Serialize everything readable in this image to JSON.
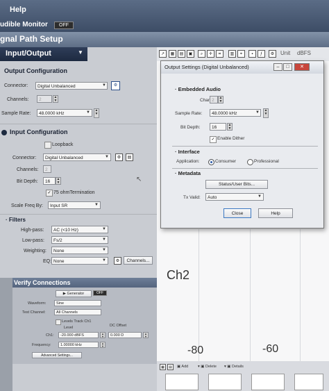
{
  "menu": {
    "help": "Help"
  },
  "audible_monitor": {
    "label": "udible Monitor",
    "state": "OFF"
  },
  "signal_path": {
    "title": "gnal Path Setup"
  },
  "io": {
    "title": "Input/Output",
    "dropdown_icon": "triangle-down"
  },
  "output_config": {
    "title": "Output Configuration",
    "connector_label": "Connector:",
    "connector_value": "Digital Unbalanced",
    "channels_label": "Channels:",
    "channels_value": "2",
    "sample_rate_label": "Sample Rate:",
    "sample_rate_value": "48.0000 kHz"
  },
  "input_config": {
    "title": "Input Configuration",
    "loopback_label": "Loopback",
    "connector_label": "Connector:",
    "connector_value": "Digital Unbalanced",
    "channels_label": "Channels:",
    "channels_value": "2",
    "bit_depth_label": "Bit Depth:",
    "bit_depth_value": "16",
    "termination_label": "75 ohmTermination",
    "scale_freq_label": "Scale Freq By:",
    "scale_freq_value": "Input SR"
  },
  "filters": {
    "title": "Filters",
    "highpass_label": "High-pass:",
    "highpass_value": "AC (<10 Hz)",
    "lowpass_label": "Low-pass:",
    "lowpass_value": "Fs/2",
    "weighting_label": "Weighting:",
    "weighting_value": "None",
    "eq_label": "EQ:",
    "eq_value": "None",
    "channels_button": "Channels..."
  },
  "verify": {
    "title": "Verify Connections",
    "generator_label": "Generator",
    "generator_state": "OFF",
    "waveform_label": "Waveform:",
    "waveform_value": "Sine",
    "test_channel_label": "Test Channel:",
    "test_channel_value": "All Channels",
    "levels_track_label": "Levels Track Ch1",
    "level_label": "Level",
    "dc_offset_label": "DC Offset",
    "ch1_label": "Ch1:",
    "ch1_level": "-20.000 dBFS",
    "ch1_dc": "0.000 D",
    "frequency_label": "Frequency:",
    "frequency_value": "1.00000 kHz",
    "advanced_button": "Advanced Settings..."
  },
  "graph": {
    "unit_label": "Unit",
    "unit_value": "dBFS",
    "ch2_label": "Ch2",
    "axis_left": "-80",
    "axis_right": "-60",
    "bottom_add": "Add",
    "bottom_delete": "Delete",
    "bottom_details": "Details"
  },
  "dialog": {
    "title": "Output Settings (Digital Unbalanced)",
    "embedded_title": "Embedded Audio",
    "channels_label": "Channels:",
    "channels_value": "2",
    "sample_rate_label": "Sample Rate:",
    "sample_rate_value": "48.0000 kHz",
    "bit_depth_label": "Bit Depth:",
    "bit_depth_value": "16",
    "dither_label": "Enable Dither",
    "interface_title": "Interface",
    "application_label": "Application:",
    "consumer_label": "Consumer",
    "professional_label": "Professional",
    "metadata_title": "Metadata",
    "status_button": "Status/User Bits...",
    "tx_valid_label": "Tx Valid:",
    "tx_valid_value": "Auto",
    "close_button": "Close",
    "help_button": "Help"
  }
}
